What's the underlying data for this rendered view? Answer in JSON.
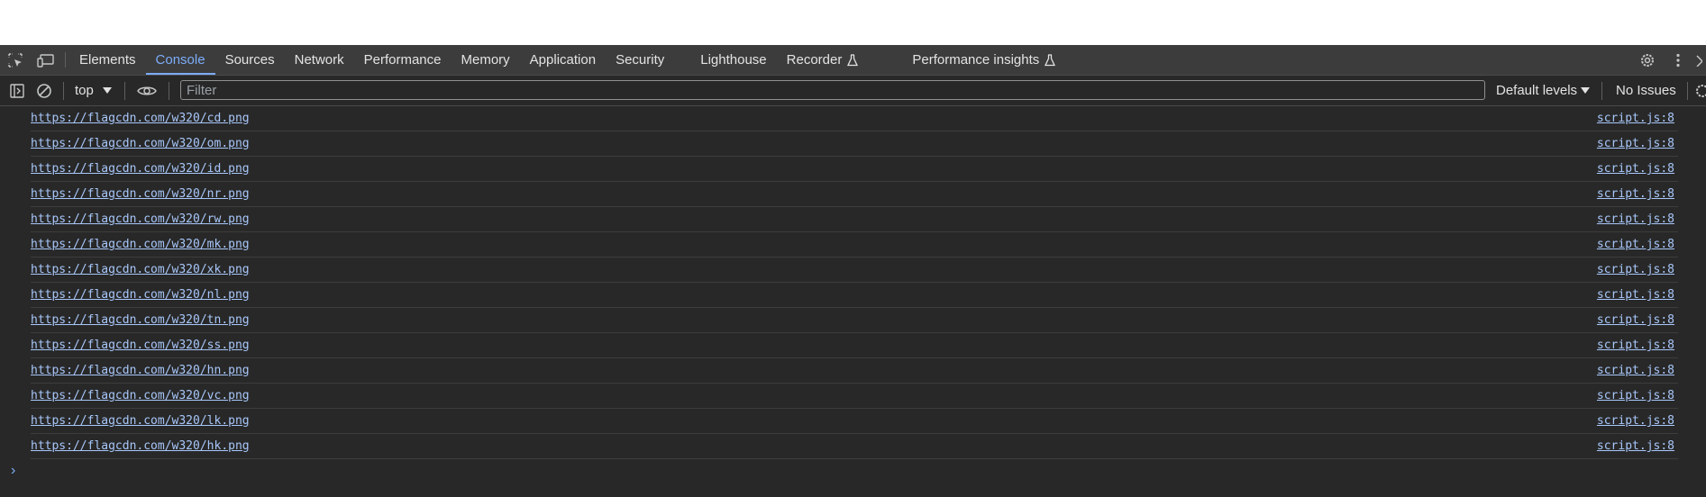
{
  "tabs": [
    {
      "label": "Elements",
      "active": false
    },
    {
      "label": "Console",
      "active": true
    },
    {
      "label": "Sources",
      "active": false
    },
    {
      "label": "Network",
      "active": false
    },
    {
      "label": "Performance",
      "active": false
    },
    {
      "label": "Memory",
      "active": false
    },
    {
      "label": "Application",
      "active": false
    },
    {
      "label": "Security",
      "active": false
    },
    {
      "label": "Lighthouse",
      "active": false
    },
    {
      "label": "Recorder",
      "active": false,
      "experimental": true
    },
    {
      "label": "Performance insights",
      "active": false,
      "experimental": true
    }
  ],
  "toolbar": {
    "context": "top",
    "filter_placeholder": "Filter",
    "levels": "Default levels",
    "issues": "No Issues"
  },
  "icons": {
    "inspect": "inspect-element-icon",
    "device": "device-toolbar-icon",
    "settings": "gear-icon",
    "menu": "more-vertical-icon",
    "sidebar": "sidebar-toggle-icon",
    "clear": "clear-console-icon",
    "eye": "live-expression-eye-icon",
    "flask": "experiment-flask-icon"
  },
  "accent_color": "#7cacf8",
  "link_color": "#a8c7fa",
  "logs": [
    {
      "message": "https://flagcdn.com/w320/cd.png",
      "source": "script.js:8"
    },
    {
      "message": "https://flagcdn.com/w320/om.png",
      "source": "script.js:8"
    },
    {
      "message": "https://flagcdn.com/w320/id.png",
      "source": "script.js:8"
    },
    {
      "message": "https://flagcdn.com/w320/nr.png",
      "source": "script.js:8"
    },
    {
      "message": "https://flagcdn.com/w320/rw.png",
      "source": "script.js:8"
    },
    {
      "message": "https://flagcdn.com/w320/mk.png",
      "source": "script.js:8"
    },
    {
      "message": "https://flagcdn.com/w320/xk.png",
      "source": "script.js:8"
    },
    {
      "message": "https://flagcdn.com/w320/nl.png",
      "source": "script.js:8"
    },
    {
      "message": "https://flagcdn.com/w320/tn.png",
      "source": "script.js:8"
    },
    {
      "message": "https://flagcdn.com/w320/ss.png",
      "source": "script.js:8"
    },
    {
      "message": "https://flagcdn.com/w320/hn.png",
      "source": "script.js:8"
    },
    {
      "message": "https://flagcdn.com/w320/vc.png",
      "source": "script.js:8"
    },
    {
      "message": "https://flagcdn.com/w320/lk.png",
      "source": "script.js:8"
    },
    {
      "message": "https://flagcdn.com/w320/hk.png",
      "source": "script.js:8"
    }
  ]
}
